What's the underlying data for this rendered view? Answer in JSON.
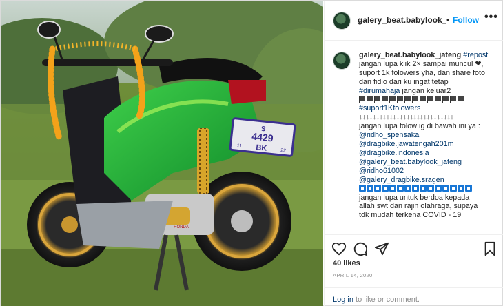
{
  "header": {
    "username": "galery_beat.babylook_jateng",
    "dot": "•",
    "follow_label": "Follow",
    "more_icon": "more-options-icon"
  },
  "caption": {
    "username": "galery_beat.babylook_jateng",
    "lines": [
      "#repost",
      "jangan lupa klik 2× sampai muncul ❤,",
      "suport 1k folowers yha, dan share foto",
      "dan fidio dari ku ingat tetap",
      "#dirumahaja jangan keluar2",
      "#suport1Kfolowers",
      "jangan lupa folow ig di bawah ini ya :",
      "@ridho_spensaka",
      "@dragbike.jawatengah201m",
      "@dragbike.indonesia",
      "@galery_beat.babylook_jateng",
      "@ridho61002",
      "@galery_dragbike.sragen",
      "jangan lupa untuk berdoa kepada",
      "allah swt dan rajin olahraga, supaya",
      "tdk mudah terkena COVID - 19"
    ],
    "arrow_line": "↓↓↓↓↓↓↓↓↓↓↓↓↓↓↓↓↓↓↓↓↓↓↓↓↓↓↓↓"
  },
  "photo": {
    "plate_top": "S",
    "plate_mid": "4429",
    "plate_code": "BK",
    "plate_left": "11",
    "plate_right": "22",
    "brand": "HONDA"
  },
  "actions": {
    "like_icon": "heart-icon",
    "comment_icon": "comment-icon",
    "share_icon": "send-icon",
    "save_icon": "bookmark-icon"
  },
  "likes_text": "40 likes",
  "date_text": "APRIL 14, 2020",
  "login": {
    "link": "Log in",
    "rest": " to like or comment."
  },
  "colors": {
    "link_blue": "#0095f6",
    "tag_blue": "#00376b",
    "muted": "#8e8e8e"
  }
}
